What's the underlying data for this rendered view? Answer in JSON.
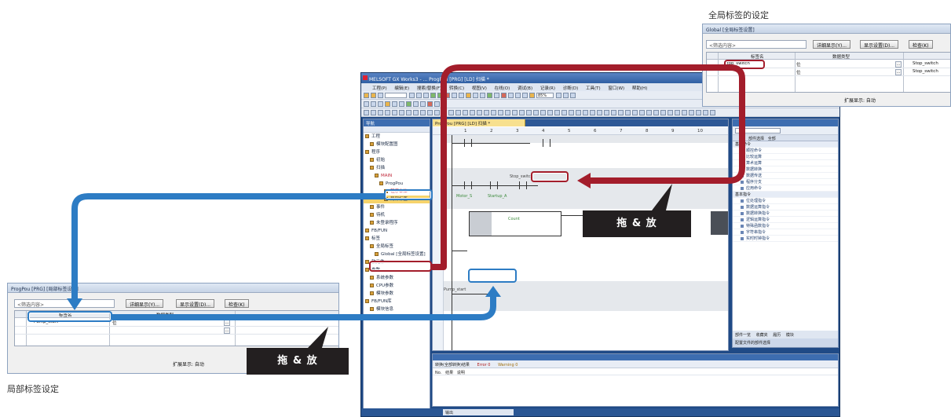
{
  "captions": {
    "global": "全局标签的设定",
    "local": "局部标签设定"
  },
  "drag_label": "拖 & 放",
  "ide": {
    "title": "MELSOFT GX Works3 - ... ProgPou [PRG] [LD] 扫描 *",
    "menu": [
      "工程(P)",
      "编辑(E)",
      "搜索/替换(F)",
      "转换(C)",
      "视图(V)",
      "在线(O)",
      "调试(B)",
      "记录(R)",
      "诊断(D)",
      "工具(T)",
      "窗口(W)",
      "帮助(H)"
    ],
    "zoom": "85%",
    "nav_title": "导航",
    "nav_items": [
      "工程",
      "模块配置图",
      "程序",
      "初始",
      "扫描",
      "MAIN",
      "ProgPou",
      "程序本体",
      "事件",
      "待机",
      "未登录程序",
      "FB/FUN",
      "标签",
      "全局标签",
      "局部标签",
      "软元件",
      "参数",
      "系统参数",
      "CPU参数",
      "模块参数",
      "FB/FUN库",
      "模块信息",
      "远程口令"
    ],
    "editor_tab": "ProgPou [PRG] [LD] 扫描 *",
    "ruler": [
      "1",
      "2",
      "3",
      "4",
      "5",
      "6",
      "7",
      "8",
      "9",
      "10"
    ],
    "ladder_text": [
      "Motor_S",
      "Startup_A",
      "Count",
      "Stop_switch",
      "Pump_start"
    ],
    "lib_header": "部件选择",
    "lib_col": "全部",
    "lib_rows": [
      "基本命令",
      "顺控命令",
      "比较运算",
      "算术运算",
      "数据转换",
      "数据传送",
      "程序分支",
      "应用命令",
      "基本指令",
      "位处理指令",
      "数据运算指令",
      "数据转换指令",
      "逻辑运算指令",
      "特殊函数指令",
      "字符串指令",
      "实时时钟指令"
    ],
    "lib_tabs": [
      "部件一览",
      "收藏夹",
      "履历",
      "模块"
    ],
    "lib_tabs2": "配置文件的部件选择",
    "output_tabs": [
      "转换(全部转换)结果",
      "Error 0",
      "Warning 0"
    ],
    "output_cols": [
      "No.",
      "结果",
      "说明"
    ],
    "status_left": "输出"
  },
  "global_window": {
    "title": "Global [全局标签设置]",
    "filter": "<筛选内容>",
    "buttons": [
      "详细显示(Y)...",
      "显示设置(D)...",
      "检查(K)"
    ],
    "col_label": "标签名",
    "col_type": "数据类型",
    "rows": [
      {
        "name": "Stop_switch",
        "type": "位",
        "device": "Stop_switch"
      },
      {
        "name": "",
        "type": "位",
        "device": "Stop_switch"
      }
    ],
    "footer": "扩展显示: 自动"
  },
  "local_window": {
    "title": "ProgPou [PRG] [局部标签设置]",
    "filter": "<筛选内容>",
    "buttons": [
      "详细显示(Y)...",
      "显示设置(D)...",
      "检查(K)"
    ],
    "col_label": "标签名",
    "col_type": "数据类型",
    "rows": [
      {
        "name": "Pump_start",
        "type": "位"
      },
      {
        "name": "",
        "type": ""
      }
    ],
    "footer": "扩展显示: 自动"
  }
}
